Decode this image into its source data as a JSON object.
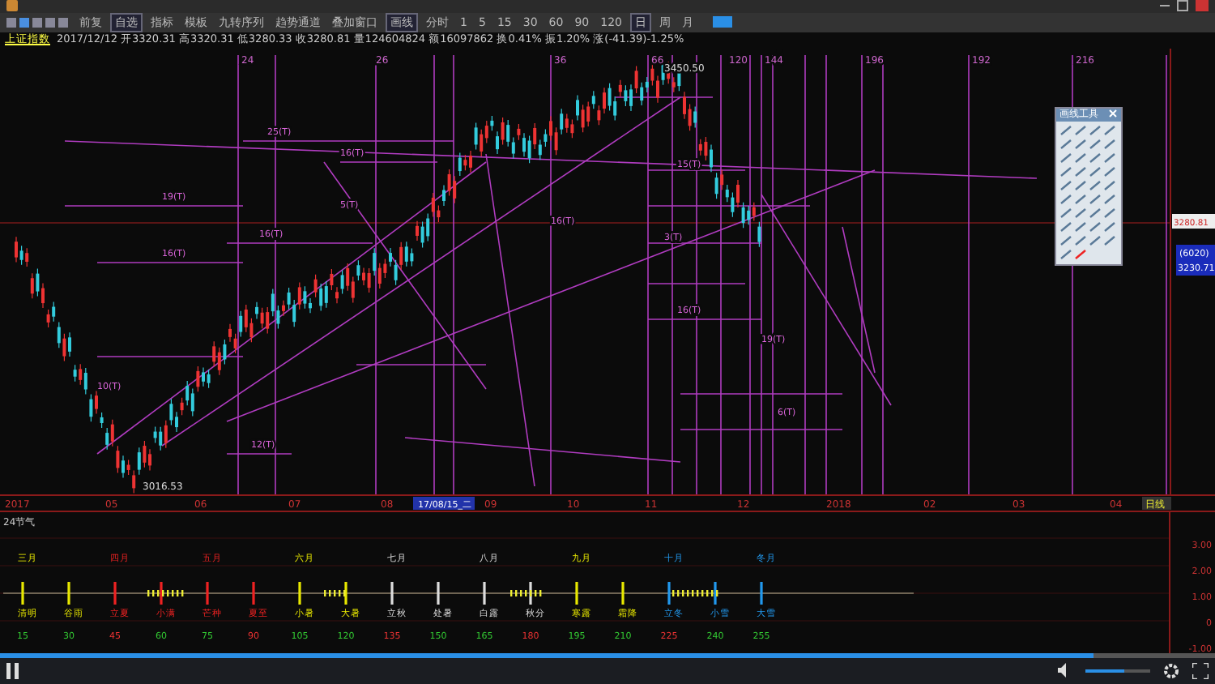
{
  "toolbar": {
    "items": [
      {
        "label": "前复",
        "kind": "button"
      },
      {
        "label": "自选",
        "kind": "select"
      },
      {
        "label": "指标",
        "kind": "button"
      },
      {
        "label": "模板",
        "kind": "button"
      },
      {
        "label": "九转序列",
        "kind": "button"
      },
      {
        "label": "趋势通道",
        "kind": "button"
      },
      {
        "label": "叠加窗口",
        "kind": "button"
      },
      {
        "label": "画线",
        "kind": "select"
      },
      {
        "label": "分时",
        "kind": "button"
      }
    ],
    "periods": [
      {
        "label": "1",
        "selected": false
      },
      {
        "label": "5",
        "selected": false
      },
      {
        "label": "15",
        "selected": false
      },
      {
        "label": "30",
        "selected": false
      },
      {
        "label": "60",
        "selected": false
      },
      {
        "label": "90",
        "selected": false
      },
      {
        "label": "120",
        "selected": false
      },
      {
        "label": "日",
        "selected": true
      },
      {
        "label": "周",
        "selected": false
      },
      {
        "label": "月",
        "selected": false
      }
    ]
  },
  "info_line": {
    "name": "上证指数",
    "text": "2017/12/12 开3320.31 高3320.31 低3280.33 收3280.81 量124604824 额16097862 换0.41% 振1.20% 涨(-41.39)-1.25%"
  },
  "chart": {
    "cycle_marks": [
      "24",
      "26",
      "36",
      "66",
      "120",
      "144",
      "196",
      "192",
      "216"
    ],
    "labels": [
      "19(T)",
      "16(T)",
      "16(T)",
      "25(T)",
      "16(T)",
      "10(T)",
      "12(T)",
      "5(T)",
      "16(T)",
      "15(T)",
      "3(T)",
      "16(T)",
      "19(T)",
      "6(T)"
    ],
    "high_label": "3450.50",
    "low_label": "3016.53",
    "price_tag": "3280.81",
    "volume_tag": "(6020)",
    "price_tag_2": "3230.71"
  },
  "x_axis": {
    "labels": [
      "2017",
      "05",
      "06",
      "07",
      "08",
      "09",
      "10",
      "11",
      "12",
      "2018",
      "02",
      "03",
      "04"
    ],
    "cursor_label": "17/08/15_二",
    "period_label": "日线"
  },
  "drawing_tools": {
    "title": "画线工具"
  },
  "solar_panel": {
    "title": "24节气",
    "y_ticks": [
      "3.00",
      "2.00",
      "1.00",
      "0",
      "-1.00"
    ],
    "terms": [
      {
        "name": "清明",
        "color": "#e8e800",
        "month": "三月",
        "number": {
          "label": "15",
          "color": "#33cc33"
        }
      },
      {
        "name": "谷雨",
        "color": "#e8e800",
        "number": {
          "label": "30",
          "color": "#33cc33"
        }
      },
      {
        "name": "立夏",
        "color": "#ee2222",
        "month": "四月",
        "number": {
          "label": "45",
          "color": "#ee3333"
        }
      },
      {
        "name": "小满",
        "color": "#ee2222",
        "number": {
          "label": "60",
          "color": "#33cc33"
        }
      },
      {
        "name": "芒种",
        "color": "#ee2222",
        "month": "五月",
        "number": {
          "label": "75",
          "color": "#33cc33"
        }
      },
      {
        "name": "夏至",
        "color": "#ee2222",
        "number": {
          "label": "90",
          "color": "#ee3333"
        }
      },
      {
        "name": "小暑",
        "color": "#e8e800",
        "month": "六月",
        "number": {
          "label": "105",
          "color": "#33cc33"
        }
      },
      {
        "name": "大暑",
        "color": "#e8e800",
        "number": {
          "label": "120",
          "color": "#33cc33"
        }
      },
      {
        "name": "立秋",
        "color": "#dddddd",
        "month": "七月",
        "number": {
          "label": "135",
          "color": "#ee3333"
        }
      },
      {
        "name": "处暑",
        "color": "#dddddd",
        "number": {
          "label": "150",
          "color": "#33cc33"
        }
      },
      {
        "name": "白露",
        "color": "#dddddd",
        "month": "八月",
        "number": {
          "label": "165",
          "color": "#33cc33"
        }
      },
      {
        "name": "秋分",
        "color": "#dddddd",
        "number": {
          "label": "180",
          "color": "#ee3333"
        }
      },
      {
        "name": "寒露",
        "color": "#e8e800",
        "month": "九月",
        "number": {
          "label": "195",
          "color": "#33cc33"
        }
      },
      {
        "name": "霜降",
        "color": "#e8e800",
        "number": {
          "label": "210",
          "color": "#33cc33"
        }
      },
      {
        "name": "立冬",
        "color": "#2299ee",
        "month": "十月",
        "number": {
          "label": "225",
          "color": "#ee3333"
        }
      },
      {
        "name": "小雪",
        "color": "#2299ee",
        "number": {
          "label": "240",
          "color": "#33cc33"
        }
      },
      {
        "name": "大雪",
        "color": "#2299ee",
        "month": "冬月",
        "number": {
          "label": "255",
          "color": "#33cc33"
        }
      }
    ]
  },
  "player": {
    "progress": {
      "level": 0.9
    },
    "volume": {
      "level": 0.6
    }
  }
}
